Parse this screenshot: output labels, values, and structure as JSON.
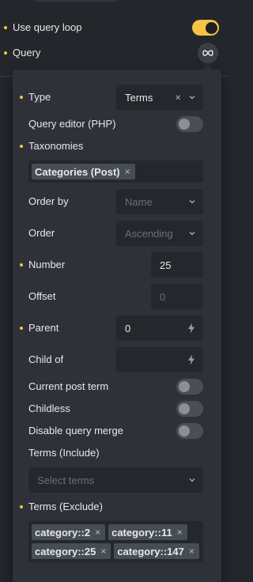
{
  "use_query_loop": {
    "label": "Use query loop",
    "enabled": true
  },
  "query": {
    "label": "Query",
    "icon": "infinity-icon"
  },
  "type": {
    "label": "Type",
    "value": "Terms",
    "clear": "×"
  },
  "query_editor": {
    "label": "Query editor (PHP)",
    "enabled": false
  },
  "taxonomies": {
    "label": "Taxonomies",
    "tags": [
      {
        "label": "Categories (Post)",
        "remove": "×"
      }
    ]
  },
  "order_by": {
    "label": "Order by",
    "placeholder": "Name"
  },
  "order": {
    "label": "Order",
    "placeholder": "Ascending"
  },
  "number": {
    "label": "Number",
    "value": "25"
  },
  "offset": {
    "label": "Offset",
    "placeholder": "0"
  },
  "parent": {
    "label": "Parent",
    "value": "0"
  },
  "child_of": {
    "label": "Child of",
    "value": ""
  },
  "current_post_term": {
    "label": "Current post term",
    "enabled": false
  },
  "childless": {
    "label": "Childless",
    "enabled": false
  },
  "disable_query_merge": {
    "label": "Disable query merge",
    "enabled": false
  },
  "terms_include": {
    "label": "Terms (Include)",
    "placeholder": "Select terms"
  },
  "terms_exclude": {
    "label": "Terms (Exclude)",
    "tags": [
      {
        "label": "category::2",
        "remove": "×"
      },
      {
        "label": "category::11",
        "remove": "×"
      },
      {
        "label": "category::25",
        "remove": "×"
      },
      {
        "label": "category::147",
        "remove": "×"
      }
    ]
  },
  "colors": {
    "accent": "#f4c544",
    "panel": "#2e3238",
    "field": "#24272c",
    "background": "#23262b"
  }
}
